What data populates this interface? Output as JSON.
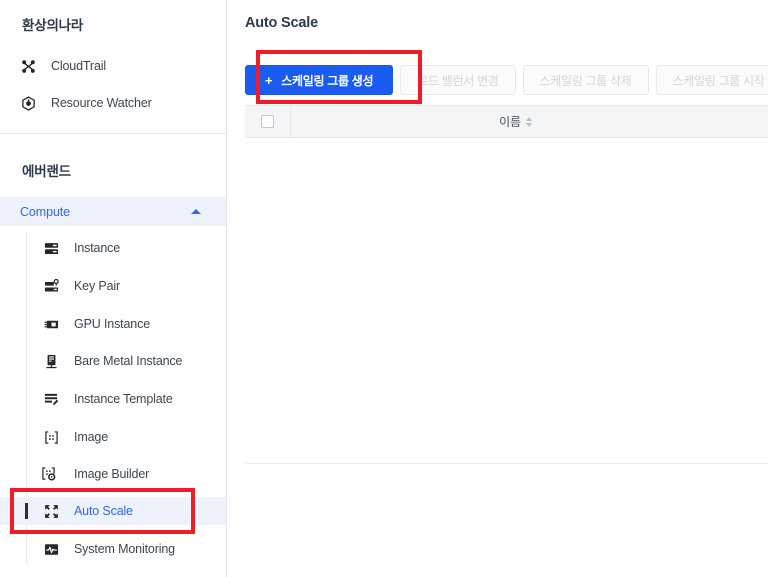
{
  "sidebar": {
    "brand_title": "환상의나라",
    "top_items": [
      {
        "label": "CloudTrail",
        "icon": "cloudtrail-icon"
      },
      {
        "label": "Resource Watcher",
        "icon": "resource-watcher-icon"
      }
    ],
    "project_title": "에버랜드",
    "group": {
      "label": "Compute",
      "expanded": true,
      "chevron": "chevron-up-icon",
      "accent_color": "#2f6bdd",
      "background_color": "#eef2fd"
    },
    "sub_items": [
      {
        "label": "Instance",
        "icon": "instance-icon",
        "active": false
      },
      {
        "label": "Key Pair",
        "icon": "key-pair-icon",
        "active": false
      },
      {
        "label": "GPU Instance",
        "icon": "gpu-instance-icon",
        "active": false
      },
      {
        "label": "Bare Metal Instance",
        "icon": "bare-metal-instance-icon",
        "active": false
      },
      {
        "label": "Instance Template",
        "icon": "instance-template-icon",
        "active": false
      },
      {
        "label": "Image",
        "icon": "image-icon",
        "active": false
      },
      {
        "label": "Image Builder",
        "icon": "image-builder-icon",
        "active": false
      },
      {
        "label": "Auto Scale",
        "icon": "auto-scale-icon",
        "active": true
      },
      {
        "label": "System Monitoring",
        "icon": "system-monitoring-icon",
        "active": false
      }
    ]
  },
  "main": {
    "page_title": "Auto Scale",
    "toolbar": {
      "primary": {
        "label": "스케일링 그룹 생성",
        "plus": "+",
        "color": "#1a5cf0"
      },
      "disabled_buttons": [
        {
          "label": "로드 밸런서 변경"
        },
        {
          "label": "스케일링 그룹 삭제"
        },
        {
          "label": "스케일링 그룹 시작"
        },
        {
          "label": ""
        }
      ]
    },
    "table": {
      "columns": [
        {
          "label": "",
          "type": "checkbox"
        },
        {
          "label": "이름",
          "sortable": true
        }
      ],
      "rows": []
    }
  },
  "annotations": {
    "highlight_color": "#f01c28",
    "boxes": [
      {
        "name": "create-scaling-group-button"
      },
      {
        "name": "sidebar-item-auto-scale"
      }
    ]
  }
}
